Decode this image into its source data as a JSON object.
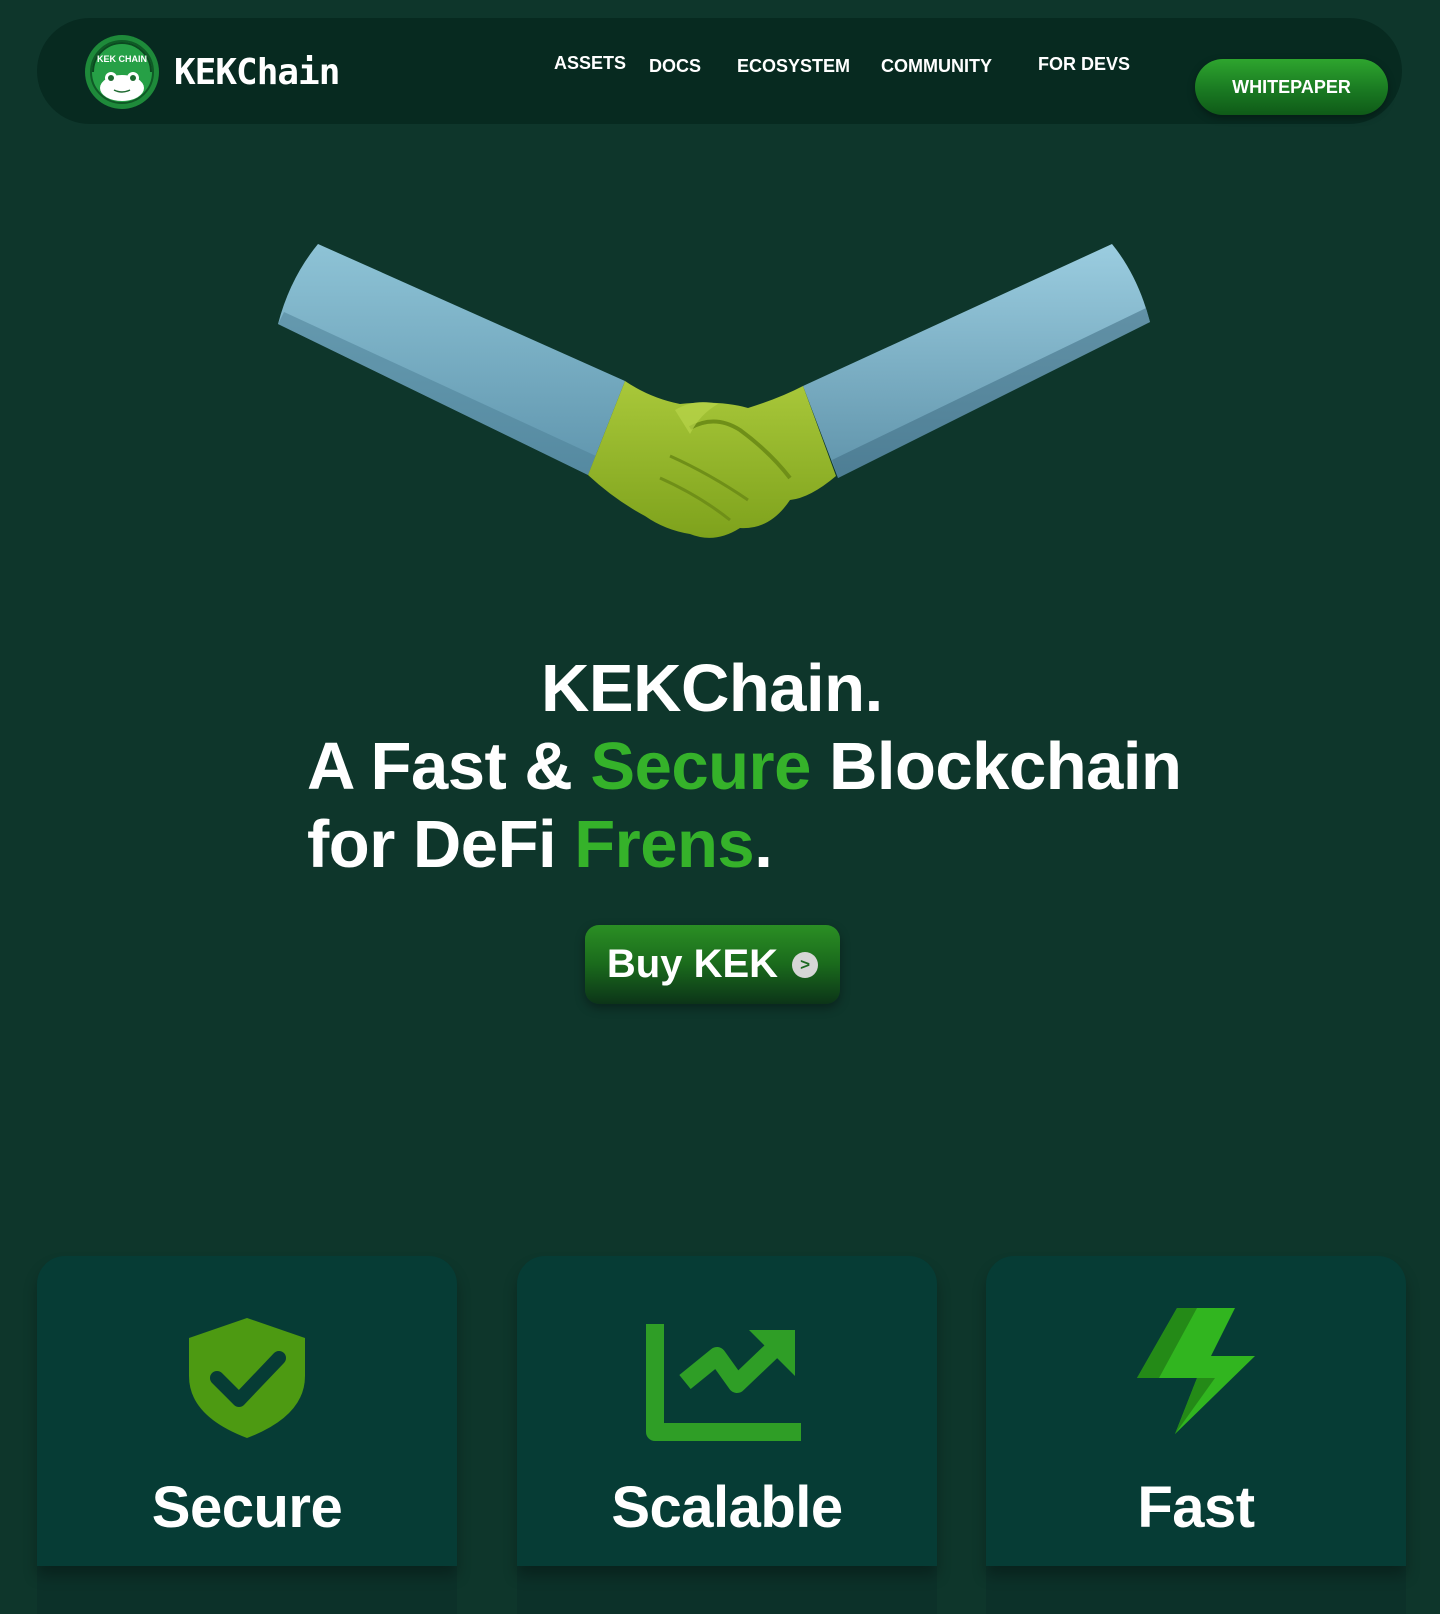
{
  "brand": {
    "name": "KEKChain",
    "badge_text": "KEK CHAIN"
  },
  "nav": {
    "links": [
      "ASSETS",
      "DOCS",
      "ECOSYSTEM",
      "COMMUNITY",
      "FOR DEVS"
    ],
    "cta": "WHITEPAPER"
  },
  "hero": {
    "line1": "KEKChain.",
    "line2_a": "A Fast & ",
    "line2_accent": "Secure",
    "line2_b": " Blockchain",
    "line3_a": "for DeFi ",
    "line3_accent": "Frens",
    "line3_b": ".",
    "image": "handshake-illustration",
    "cta": "Buy KEK",
    "cta_icon": "arrow-right-circle-icon",
    "cta_arrow": ">"
  },
  "features": [
    {
      "title": "Secure",
      "icon": "shield-check-icon"
    },
    {
      "title": "Scalable",
      "icon": "trending-chart-icon"
    },
    {
      "title": "Fast",
      "icon": "lightning-bolt-icon"
    }
  ],
  "colors": {
    "background": "#0e362b",
    "nav_background": "#072a20",
    "card_background": "#063c35",
    "accent_green": "#35b22a",
    "button_green": "#1a7a22"
  }
}
